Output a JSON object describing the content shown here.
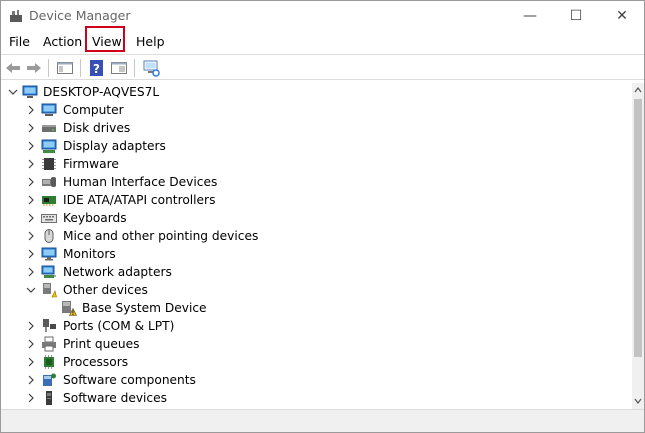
{
  "window": {
    "title": "Device Manager",
    "controls": {
      "minimize": "—",
      "maximize": "☐",
      "close": "✕"
    }
  },
  "menu": {
    "file": "File",
    "action": "Action",
    "view": "View",
    "help": "Help",
    "highlighted": "View",
    "highlight_color": "#d0021b"
  },
  "toolbar": {
    "icons": [
      "back-arrow-icon",
      "forward-arrow-icon",
      "console-tree-icon",
      "help-icon",
      "properties-icon",
      "scan-hardware-icon"
    ]
  },
  "tree": {
    "root": "DESKTOP-AQVES7L",
    "categories": [
      {
        "label": "Computer",
        "icon": "computer-icon",
        "expanded": false
      },
      {
        "label": "Disk drives",
        "icon": "disk-drive-icon",
        "expanded": false
      },
      {
        "label": "Display adapters",
        "icon": "display-adapter-icon",
        "expanded": false
      },
      {
        "label": "Firmware",
        "icon": "firmware-icon",
        "expanded": false
      },
      {
        "label": "Human Interface Devices",
        "icon": "hid-icon",
        "expanded": false
      },
      {
        "label": "IDE ATA/ATAPI controllers",
        "icon": "ide-controller-icon",
        "expanded": false
      },
      {
        "label": "Keyboards",
        "icon": "keyboard-icon",
        "expanded": false
      },
      {
        "label": "Mice and other pointing devices",
        "icon": "mouse-icon",
        "expanded": false
      },
      {
        "label": "Monitors",
        "icon": "monitor-icon",
        "expanded": false
      },
      {
        "label": "Network adapters",
        "icon": "network-adapter-icon",
        "expanded": false
      },
      {
        "label": "Other devices",
        "icon": "other-devices-icon",
        "expanded": true
      },
      {
        "label": "Ports (COM & LPT)",
        "icon": "port-icon",
        "expanded": false
      },
      {
        "label": "Print queues",
        "icon": "printer-icon",
        "expanded": false
      },
      {
        "label": "Processors",
        "icon": "processor-icon",
        "expanded": false
      },
      {
        "label": "Software components",
        "icon": "software-component-icon",
        "expanded": false
      },
      {
        "label": "Software devices",
        "icon": "software-device-icon",
        "expanded": false
      }
    ],
    "other_devices_children": [
      {
        "label": "Base System Device",
        "icon": "warning-device-icon"
      }
    ]
  },
  "colors": {
    "icon_blue": "#2b7bd8",
    "warning_yellow": "#f5c400"
  }
}
